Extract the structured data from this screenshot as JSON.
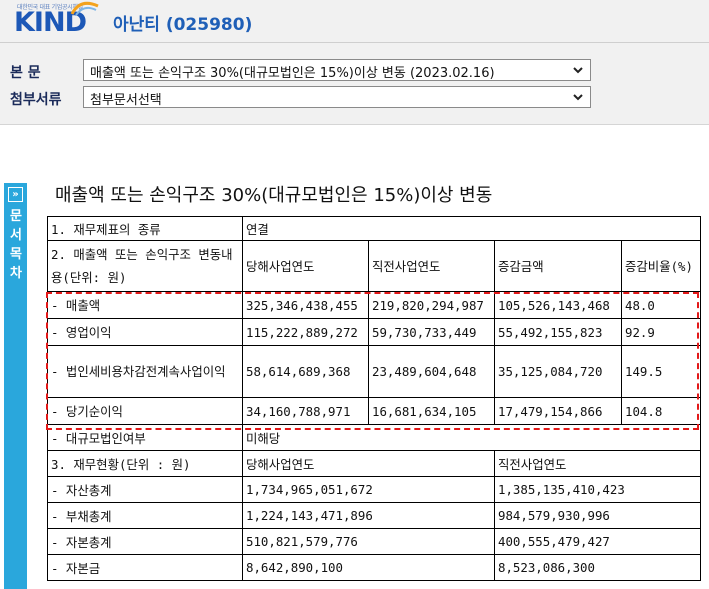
{
  "header": {
    "logo_tagline": "대한민국 대표 기업공시채널",
    "logo_text": "KIND",
    "company_title": "아난티 (025980)"
  },
  "nav": {
    "main_label": "본 문",
    "main_select": "매출액 또는 손익구조 30%(대규모법인은 15%)이상 변동 (2023.02.16)",
    "attach_label": "첨부서류",
    "attach_select": "첨부문서선택"
  },
  "toc": {
    "arrow": "»",
    "label": "문서목차"
  },
  "document": {
    "title": "매출액 또는 손익구조 30%(대규모법인은 15%)이상 변동"
  },
  "table": {
    "r1": {
      "label": "1. 재무제표의 종류",
      "value": "연결"
    },
    "r2": {
      "label": "2. 매출액 또는 손익구조 변동내용(단위: 원)",
      "h1": "당해사업연도",
      "h2": "직전사업연도",
      "h3": "증감금액",
      "h4": "증감비율(%)"
    },
    "items": [
      {
        "label": "- 매출액",
        "cur": "325,346,438,455",
        "prev": "219,820,294,987",
        "diff": "105,526,143,468",
        "rate": "48.0"
      },
      {
        "label": "- 영업이익",
        "cur": "115,222,889,272",
        "prev": "59,730,733,449",
        "diff": "55,492,155,823",
        "rate": "92.9"
      },
      {
        "label": "- 법인세비용차감전계속사업이익",
        "cur": "58,614,689,368",
        "prev": "23,489,604,648",
        "diff": "35,125,084,720",
        "rate": "149.5"
      },
      {
        "label": "- 당기순이익",
        "cur": "34,160,788,971",
        "prev": "16,681,634,105",
        "diff": "17,479,154,866",
        "rate": "104.8"
      }
    ],
    "large_corp": {
      "label": "- 대규모법인여부",
      "value": "미해당"
    },
    "r3": {
      "label": "3. 재무현황(단위 : 원)",
      "h1": "당해사업연도",
      "h2": "직전사업연도"
    },
    "fin": [
      {
        "label": "- 자산총계",
        "cur": "1,734,965,051,672",
        "prev": "1,385,135,410,423"
      },
      {
        "label": "- 부채총계",
        "cur": "1,224,143,471,896",
        "prev": "984,579,930,996"
      },
      {
        "label": "- 자본총계",
        "cur": "510,821,579,776",
        "prev": "400,555,479,427"
      },
      {
        "label": "- 자본금",
        "cur": "8,642,890,100",
        "prev": "8,523,086,300"
      }
    ]
  },
  "colors": {
    "brand_blue": "#1d58b7",
    "toc_blue": "#2aa7dc",
    "highlight_red": "#e31919"
  }
}
